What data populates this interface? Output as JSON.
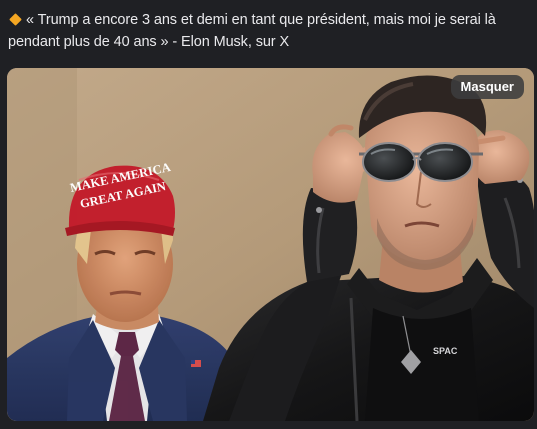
{
  "post": {
    "icon": "orange-diamond-icon",
    "text": "« Trump a encore 3 ans et demi en tant que président, mais moi je serai là pendant plus de 40 ans » - Elon Musk, sur X"
  },
  "media": {
    "hide_label": "Masquer",
    "hat_line1": "MAKE AMERICA",
    "hat_line2": "GREAT AGAIN",
    "shirt_text": "SPAC"
  },
  "colors": {
    "background": "#1f2024",
    "text": "#e9e9ec",
    "accent_diamond": "#f4a623",
    "hide_button_bg": "#3c3c3e"
  }
}
